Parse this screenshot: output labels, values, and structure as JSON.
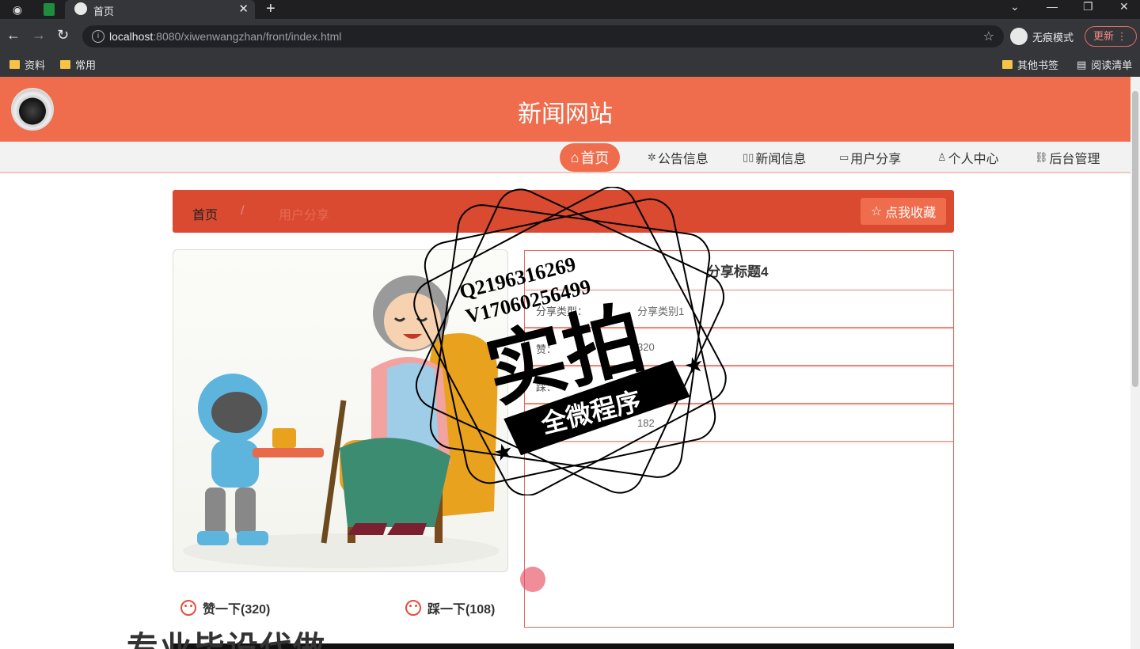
{
  "browser": {
    "tab_title": "首页",
    "url_host": "localhost",
    "url_rest": ":8080/xiwenwangzhan/front/index.html",
    "incognito_label": "无痕模式",
    "update_label": "更新",
    "bookmarks": [
      "资料",
      "常用"
    ],
    "bookmarks_right": [
      "其他书签",
      "阅读清单"
    ]
  },
  "site": {
    "title": "新闻网站"
  },
  "nav": {
    "home": "首页",
    "items": [
      "公告信息",
      "新闻信息",
      "用户分享",
      "个人中心",
      "后台管理"
    ]
  },
  "breadcrumb": {
    "home": "首页",
    "separator": "/",
    "current": "用户分享",
    "favorite_button": "点我收藏"
  },
  "detail": {
    "title": "分享标题4",
    "rows": [
      {
        "key": "分享类型：",
        "value": "分享类别1"
      },
      {
        "key": "赞：",
        "value": "320"
      },
      {
        "key": "踩：",
        "value": "108"
      },
      {
        "key": "点击次数：",
        "value": "182"
      }
    ]
  },
  "votes": {
    "like": "赞一下(320)",
    "dislike": "踩一下(108)"
  },
  "watermark": {
    "qq": "Q2196316269",
    "vx": "V17060256499",
    "main": "实拍",
    "ribbon": "全微程序",
    "bottom": "专业毕设代做"
  },
  "colors": {
    "brand": "#ef6d4d",
    "breadcrumb_bg": "#d94a30"
  }
}
